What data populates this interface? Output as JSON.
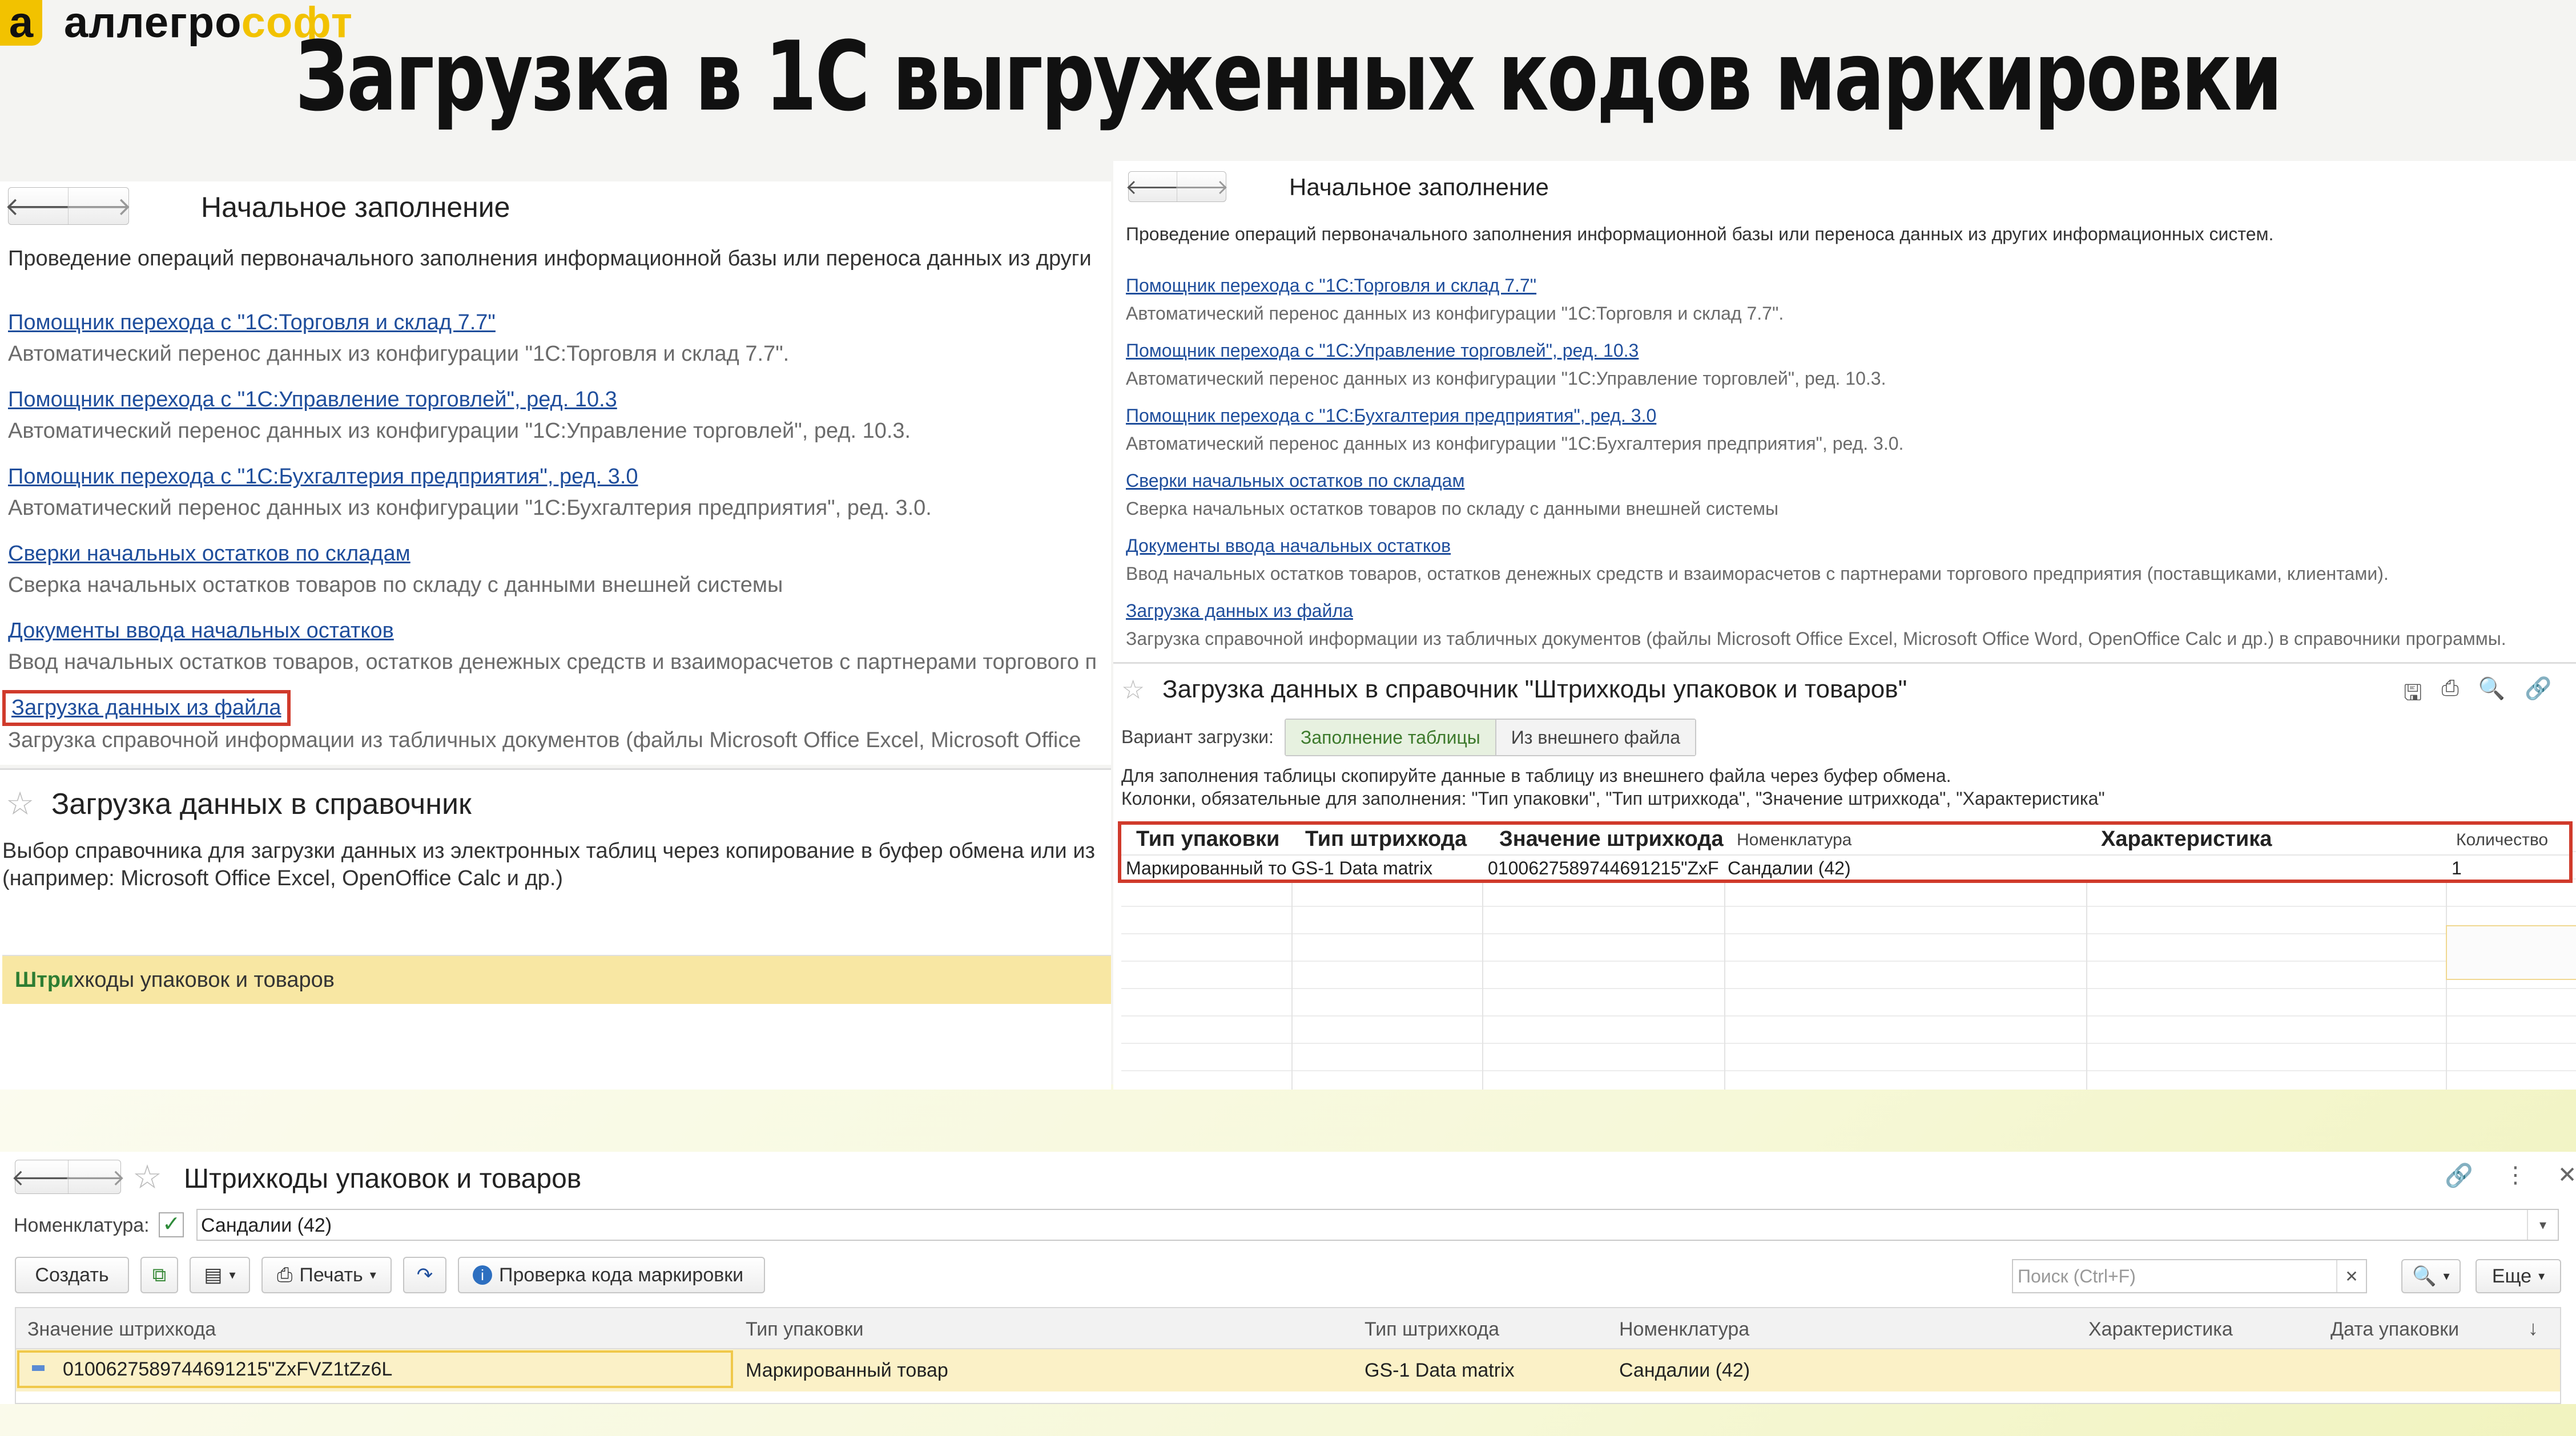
{
  "brand": {
    "mark": "a",
    "part1": "аллегро",
    "part2": "софт"
  },
  "slide_title": "Загрузка в 1С выгруженных кодов маркировки",
  "left_panel": {
    "title": "Начальное заполнение",
    "description": "Проведение операций первоначального заполнения информационной базы или переноса данных из други",
    "items": [
      {
        "link": "Помощник перехода с \"1С:Торговля и склад 7.7\"",
        "desc": "Автоматический перенос данных из конфигурации \"1С:Торговля и склад 7.7\"."
      },
      {
        "link": "Помощник перехода с \"1С:Управление торговлей\", ред. 10.3",
        "desc": "Автоматический перенос данных из конфигурации \"1С:Управление торговлей\", ред. 10.3."
      },
      {
        "link": "Помощник перехода с \"1С:Бухгалтерия предприятия\", ред. 3.0",
        "desc": "Автоматический перенос данных из конфигурации \"1С:Бухгалтерия предприятия\", ред. 3.0."
      },
      {
        "link": "Сверки начальных остатков по складам",
        "desc": "Сверка начальных остатков товаров по складу с данными внешней системы"
      },
      {
        "link": "Документы ввода начальных остатков",
        "desc": "Ввод начальных остатков товаров, остатков денежных средств и взаиморасчетов с партнерами торгового п"
      },
      {
        "link": "Загрузка данных из файла",
        "desc": "Загрузка справочной информации из табличных документов (файлы Microsoft Office Excel, Microsoft Office"
      }
    ]
  },
  "left_lower": {
    "title": "Загрузка данных в справочник",
    "description1": "Выбор справочника для загрузки данных из электронных таблиц через копирование в буфер обмена или из",
    "description2": "(например: Microsoft Office Excel, OpenOffice Calc и др.)",
    "selected_bold": "Штри",
    "selected_rest": "хкоды упаковок и товаров"
  },
  "right_panel": {
    "title": "Начальное заполнение",
    "description": "Проведение операций первоначального заполнения информационной базы или переноса данных из других информационных систем.",
    "items": [
      {
        "link": "Помощник перехода с \"1С:Торговля и склад 7.7\"",
        "desc": "Автоматический перенос данных из конфигурации \"1С:Торговля и склад 7.7\"."
      },
      {
        "link": "Помощник перехода с \"1С:Управление торговлей\", ред. 10.3",
        "desc": "Автоматический перенос данных из конфигурации \"1С:Управление торговлей\", ред. 10.3."
      },
      {
        "link": "Помощник перехода с \"1С:Бухгалтерия предприятия\", ред. 3.0",
        "desc": "Автоматический перенос данных из конфигурации \"1С:Бухгалтерия предприятия\", ред. 3.0."
      },
      {
        "link": "Сверки начальных остатков по складам",
        "desc": "Сверка начальных остатков товаров по складу с данными внешней системы"
      },
      {
        "link": "Документы ввода начальных остатков",
        "desc": "Ввод начальных остатков товаров, остатков денежных средств и взаиморасчетов с партнерами торгового предприятия (поставщиками, клиентами)."
      },
      {
        "link": "Загрузка данных из файла",
        "desc": "Загрузка справочной информации из табличных документов (файлы Microsoft Office Excel, Microsoft Office Word, OpenOffice Calc и др.) в справочники программы."
      }
    ]
  },
  "import_form": {
    "title": "Загрузка данных в справочник \"Штрихкоды упаковок и товаров\"",
    "variant_label": "Вариант загрузки:",
    "variant_options": [
      "Заполнение таблицы",
      "Из внешнего файла"
    ],
    "hint1": "Для заполнения таблицы скопируйте данные в таблицу из внешнего файла через буфер обмена.",
    "hint2": "Колонки, обязательные для заполнения: \"Тип упаковки\", \"Тип штрихкода\", \"Значение штрихкода\", \"Характеристика\"",
    "columns": [
      "Тип упаковки",
      "Тип штрихкода",
      "Значение штрихкода",
      "Номенклатура",
      "Характеристика",
      "Количество"
    ],
    "row": [
      "Маркированный то",
      "GS-1 Data matrix",
      "0100627589744691215\"ZxF",
      "Сандалии (42)",
      "",
      "1"
    ]
  },
  "list_form": {
    "title": "Штрихкоды упаковок и товаров",
    "filter_label": "Номенклатура:",
    "filter_value": "Сандалии (42)",
    "create": "Создать",
    "print": "Печать",
    "check": "Проверка кода маркировки",
    "search_placeholder": "Поиск (Ctrl+F)",
    "more": "Еще",
    "columns": [
      "Значение штрихкода",
      "Тип упаковки",
      "Тип штрихкода",
      "Номенклатура",
      "Характеристика",
      "Дата упаковки"
    ],
    "row": [
      "0100627589744691215\"ZxFVZ1tZz6L",
      "Маркированный товар",
      "GS-1 Data matrix",
      "Сандалии (42)",
      "",
      ""
    ]
  }
}
